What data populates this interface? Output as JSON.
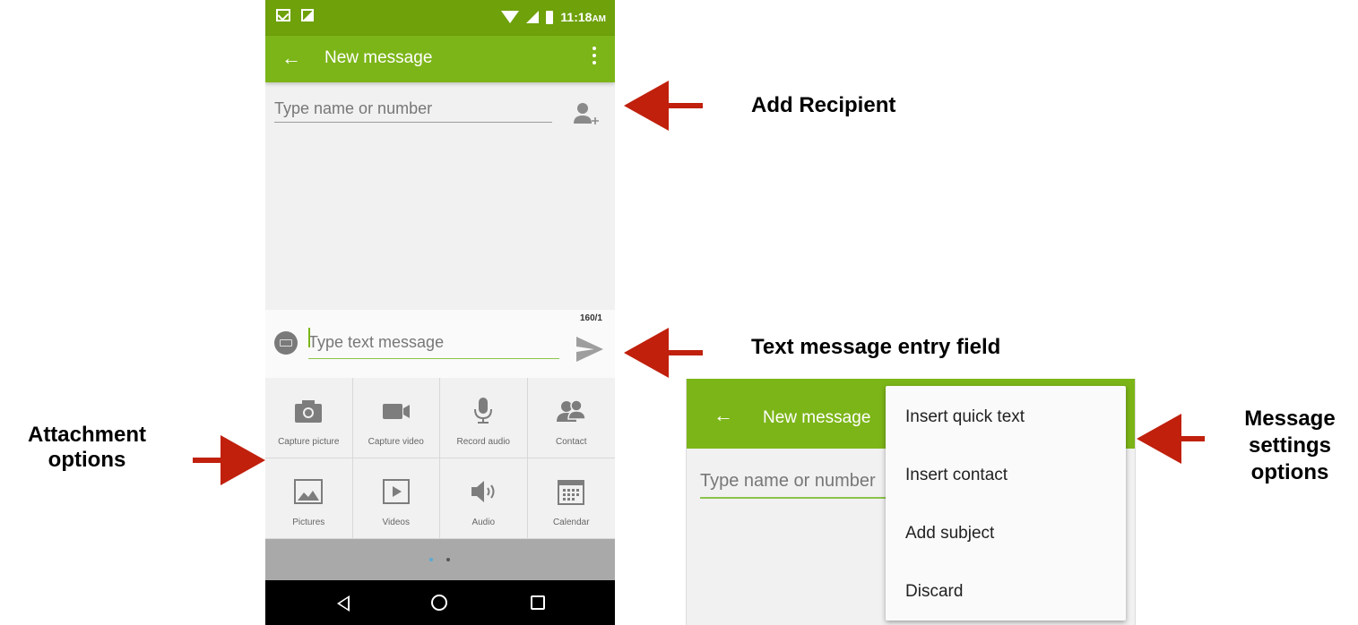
{
  "phone": {
    "status_time": "11:18",
    "status_ampm": "AM",
    "title": "New message",
    "recipient_placeholder": "Type name or number",
    "char_counter": "160/1",
    "message_placeholder": "Type text message",
    "attachments": [
      {
        "label": "Capture picture",
        "icon": "camera-icon"
      },
      {
        "label": "Capture video",
        "icon": "video-camera-icon"
      },
      {
        "label": "Record audio",
        "icon": "microphone-icon"
      },
      {
        "label": "Contact",
        "icon": "contact-icon"
      },
      {
        "label": "Pictures",
        "icon": "picture-icon"
      },
      {
        "label": "Videos",
        "icon": "video-icon"
      },
      {
        "label": "Audio",
        "icon": "speaker-icon"
      },
      {
        "label": "Calendar",
        "icon": "calendar-icon"
      }
    ],
    "page_dots": {
      "count": 2,
      "active": 0
    }
  },
  "screenshot2": {
    "title": "New message",
    "recipient_placeholder": "Type name or number",
    "menu_items": [
      "Insert quick text",
      "Insert contact",
      "Add subject",
      "Discard"
    ]
  },
  "callouts": {
    "add_recipient": "Add Recipient",
    "text_entry": "Text message entry field",
    "attachment_line1": "Attachment",
    "attachment_line2": "options",
    "settings_line1": "Message",
    "settings_line2": "settings",
    "settings_line3": "options"
  },
  "colors": {
    "status_bar": "#6ea10a",
    "toolbar": "#7cb518",
    "arrow": "#c0200c",
    "active_dot": "#5aa9d6"
  }
}
